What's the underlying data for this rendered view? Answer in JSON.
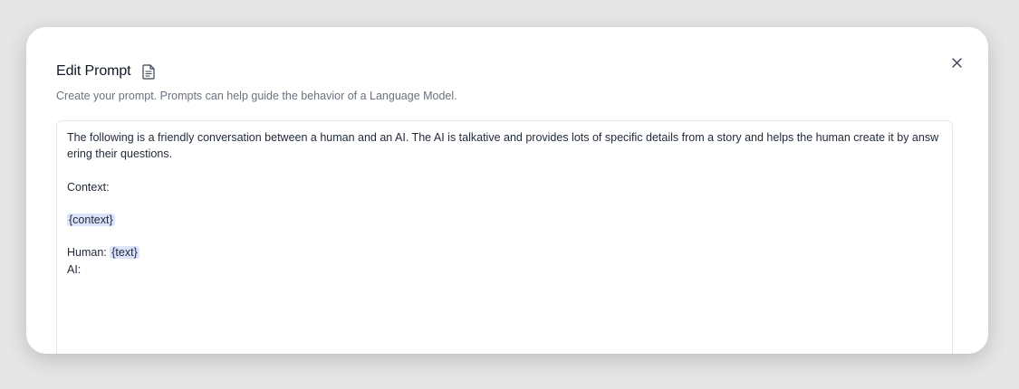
{
  "modal": {
    "title": "Edit Prompt",
    "subtitle": "Create your prompt. Prompts can help guide the behavior of a Language Model.",
    "close_icon": "close-icon",
    "title_icon": "document-icon"
  },
  "editor": {
    "intro": "The following is a friendly conversation between a human and an AI. The AI is talkative and provides lots of specific details from a story and helps the human create it by answering their questions.",
    "context_label": "Context:",
    "context_var": "{context}",
    "human_label": "Human: ",
    "text_var": "{text}",
    "ai_label": "AI:"
  },
  "colors": {
    "variable_highlight": "#dbe4fb",
    "subtitle": "#6b7280"
  }
}
